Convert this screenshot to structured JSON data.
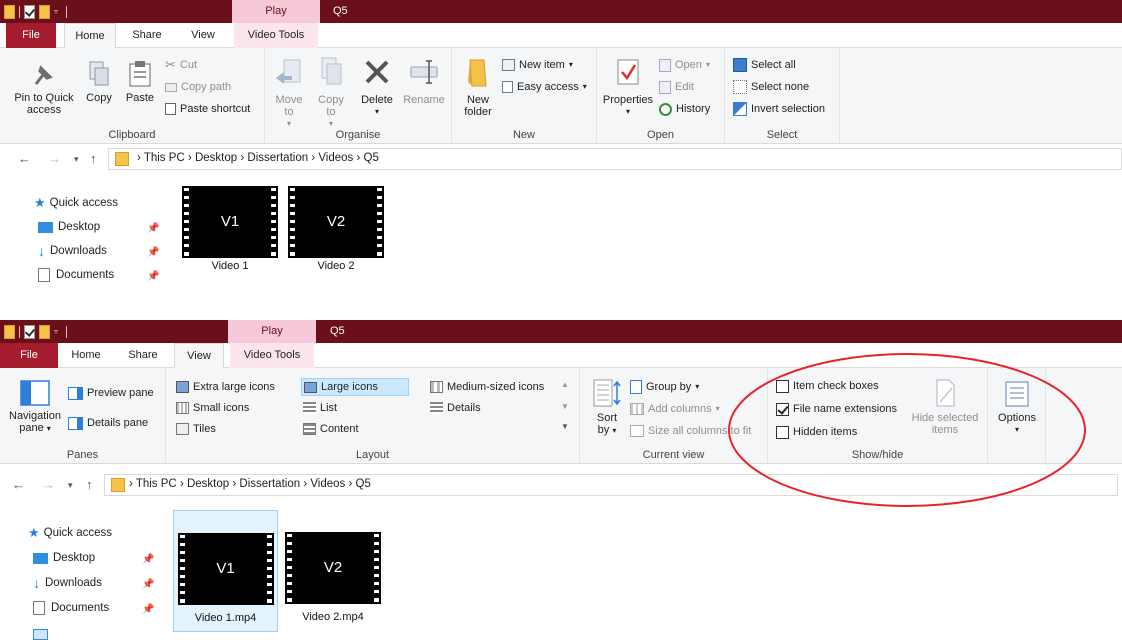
{
  "screenshot1": {
    "titlebar": {
      "context_tab": "Play",
      "window_title": "Q5"
    },
    "tabs": {
      "file": "File",
      "home": "Home",
      "share": "Share",
      "view": "View",
      "video_tools": "Video Tools"
    },
    "ribbon": {
      "clipboard": {
        "label": "Clipboard",
        "pin_to_quick_access": "Pin to Quick access",
        "copy": "Copy",
        "paste": "Paste",
        "cut": "Cut",
        "copy_path": "Copy path",
        "paste_shortcut": "Paste shortcut"
      },
      "organise": {
        "label": "Organise",
        "move_to": "Move to",
        "copy_to": "Copy to",
        "delete": "Delete",
        "rename": "Rename"
      },
      "new": {
        "label": "New",
        "new_folder": "New folder",
        "new_item": "New item",
        "easy_access": "Easy access"
      },
      "open": {
        "label": "Open",
        "properties": "Properties",
        "open": "Open",
        "edit": "Edit",
        "history": "History"
      },
      "select": {
        "label": "Select",
        "select_all": "Select all",
        "select_none": "Select none",
        "invert_selection": "Invert selection"
      }
    },
    "address": {
      "items": [
        "This PC",
        "Desktop",
        "Dissertation",
        "Videos",
        "Q5"
      ]
    },
    "nav": {
      "quick_access": "Quick access",
      "desktop": "Desktop",
      "downloads": "Downloads",
      "documents": "Documents"
    },
    "files": [
      {
        "thumb": "V1",
        "name": "Video 1"
      },
      {
        "thumb": "V2",
        "name": "Video 2"
      }
    ]
  },
  "screenshot2": {
    "titlebar": {
      "context_tab": "Play",
      "window_title": "Q5"
    },
    "tabs": {
      "file": "File",
      "home": "Home",
      "share": "Share",
      "view": "View",
      "video_tools": "Video Tools"
    },
    "ribbon": {
      "panes": {
        "label": "Panes",
        "navigation_pane": "Navigation pane",
        "preview_pane": "Preview pane",
        "details_pane": "Details pane"
      },
      "layout": {
        "label": "Layout",
        "extra_large_icons": "Extra large icons",
        "large_icons": "Large icons",
        "medium_icons": "Medium-sized icons",
        "small_icons": "Small icons",
        "list": "List",
        "details": "Details",
        "tiles": "Tiles",
        "content": "Content"
      },
      "current_view": {
        "label": "Current view",
        "sort_by": "Sort by",
        "group_by": "Group by",
        "add_columns": "Add columns",
        "size_all_columns": "Size all columns to fit"
      },
      "show_hide": {
        "label": "Show/hide",
        "item_check_boxes": "Item check boxes",
        "file_name_extensions": "File name extensions",
        "hidden_items": "Hidden items",
        "hide_selected_items": "Hide selected items",
        "item_check_boxes_checked": false,
        "file_name_extensions_checked": true,
        "hidden_items_checked": false
      },
      "options": {
        "label": "Options"
      }
    },
    "address": {
      "items": [
        "This PC",
        "Desktop",
        "Dissertation",
        "Videos",
        "Q5"
      ]
    },
    "nav": {
      "quick_access": "Quick access",
      "desktop": "Desktop",
      "downloads": "Downloads",
      "documents": "Documents"
    },
    "files": [
      {
        "thumb": "V1",
        "name": "Video 1.mp4"
      },
      {
        "thumb": "V2",
        "name": "Video 2.mp4"
      }
    ]
  },
  "colors": {
    "titlebar": "#6b0f1a",
    "context_tab": "#f6c8d8",
    "file_tab": "#a51c2e",
    "highlight_circle": "#e8232b"
  }
}
